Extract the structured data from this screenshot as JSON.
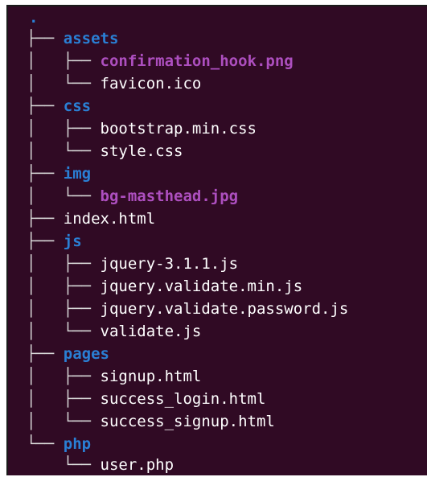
{
  "tree": {
    "root": ".",
    "rows": [
      {
        "prefix": "├── ",
        "name": "assets",
        "kind": "dir"
      },
      {
        "prefix": "│   ├── ",
        "name": "confirmation_hook.png",
        "kind": "image"
      },
      {
        "prefix": "│   └── ",
        "name": "favicon.ico",
        "kind": "file"
      },
      {
        "prefix": "├── ",
        "name": "css",
        "kind": "dir"
      },
      {
        "prefix": "│   ├── ",
        "name": "bootstrap.min.css",
        "kind": "file"
      },
      {
        "prefix": "│   └── ",
        "name": "style.css",
        "kind": "file"
      },
      {
        "prefix": "├── ",
        "name": "img",
        "kind": "dir"
      },
      {
        "prefix": "│   └── ",
        "name": "bg-masthead.jpg",
        "kind": "image"
      },
      {
        "prefix": "├── ",
        "name": "index.html",
        "kind": "file"
      },
      {
        "prefix": "├── ",
        "name": "js",
        "kind": "dir"
      },
      {
        "prefix": "│   ├── ",
        "name": "jquery-3.1.1.js",
        "kind": "file"
      },
      {
        "prefix": "│   ├── ",
        "name": "jquery.validate.min.js",
        "kind": "file"
      },
      {
        "prefix": "│   ├── ",
        "name": "jquery.validate.password.js",
        "kind": "file"
      },
      {
        "prefix": "│   └── ",
        "name": "validate.js",
        "kind": "file"
      },
      {
        "prefix": "├── ",
        "name": "pages",
        "kind": "dir"
      },
      {
        "prefix": "│   ├── ",
        "name": "signup.html",
        "kind": "file"
      },
      {
        "prefix": "│   ├── ",
        "name": "success_login.html",
        "kind": "file"
      },
      {
        "prefix": "│   └── ",
        "name": "success_signup.html",
        "kind": "file"
      },
      {
        "prefix": "└── ",
        "name": "php",
        "kind": "dir"
      },
      {
        "prefix": "    └── ",
        "name": "user.php",
        "kind": "file"
      }
    ]
  },
  "colors": {
    "background": "#300a24",
    "directory": "#2a7fd4",
    "image_file": "#ad4fbf",
    "regular_file": "#ffffff"
  }
}
